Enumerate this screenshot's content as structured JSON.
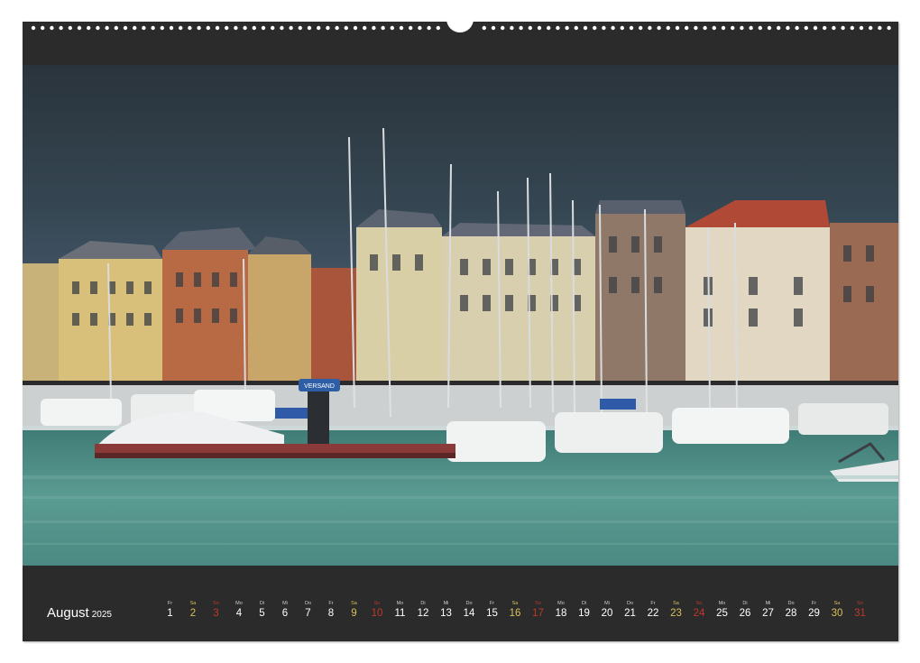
{
  "calendar": {
    "month": "August",
    "year": "2025",
    "days": [
      {
        "dow": "Fr",
        "num": "1",
        "type": "weekday"
      },
      {
        "dow": "Sa",
        "num": "2",
        "type": "sat"
      },
      {
        "dow": "So",
        "num": "3",
        "type": "sun"
      },
      {
        "dow": "Mo",
        "num": "4",
        "type": "weekday"
      },
      {
        "dow": "Di",
        "num": "5",
        "type": "weekday"
      },
      {
        "dow": "Mi",
        "num": "6",
        "type": "weekday"
      },
      {
        "dow": "Do",
        "num": "7",
        "type": "weekday"
      },
      {
        "dow": "Fr",
        "num": "8",
        "type": "weekday"
      },
      {
        "dow": "Sa",
        "num": "9",
        "type": "sat"
      },
      {
        "dow": "So",
        "num": "10",
        "type": "sun"
      },
      {
        "dow": "Mo",
        "num": "11",
        "type": "weekday"
      },
      {
        "dow": "Di",
        "num": "12",
        "type": "weekday"
      },
      {
        "dow": "Mi",
        "num": "13",
        "type": "weekday"
      },
      {
        "dow": "Do",
        "num": "14",
        "type": "weekday"
      },
      {
        "dow": "Fr",
        "num": "15",
        "type": "weekday"
      },
      {
        "dow": "Sa",
        "num": "16",
        "type": "sat"
      },
      {
        "dow": "So",
        "num": "17",
        "type": "sun"
      },
      {
        "dow": "Mo",
        "num": "18",
        "type": "weekday"
      },
      {
        "dow": "Di",
        "num": "19",
        "type": "weekday"
      },
      {
        "dow": "Mi",
        "num": "20",
        "type": "weekday"
      },
      {
        "dow": "Do",
        "num": "21",
        "type": "weekday"
      },
      {
        "dow": "Fr",
        "num": "22",
        "type": "weekday"
      },
      {
        "dow": "Sa",
        "num": "23",
        "type": "sat"
      },
      {
        "dow": "So",
        "num": "24",
        "type": "sun"
      },
      {
        "dow": "Mo",
        "num": "25",
        "type": "weekday"
      },
      {
        "dow": "Di",
        "num": "26",
        "type": "weekday"
      },
      {
        "dow": "Mi",
        "num": "27",
        "type": "weekday"
      },
      {
        "dow": "Do",
        "num": "28",
        "type": "weekday"
      },
      {
        "dow": "Fr",
        "num": "29",
        "type": "weekday"
      },
      {
        "dow": "Sa",
        "num": "30",
        "type": "sat"
      },
      {
        "dow": "So",
        "num": "31",
        "type": "sun"
      }
    ]
  },
  "photo": {
    "sign_text": "VERSAND",
    "colors": {
      "sky": "#2f3a44",
      "water": "#4f8f87",
      "frame": "#2b2b2b",
      "saturday": "#d8c15a",
      "sunday": "#c0392b"
    }
  }
}
